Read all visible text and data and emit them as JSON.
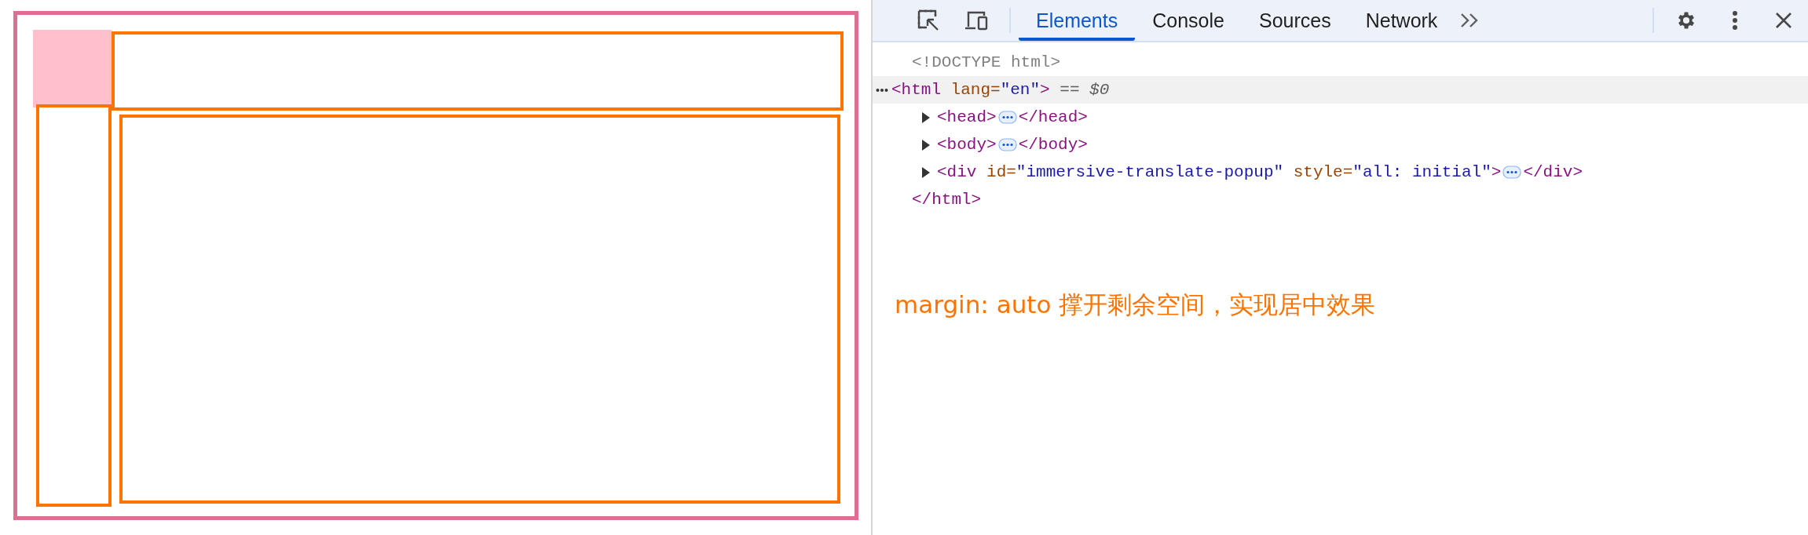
{
  "toolbar": {
    "tabs": [
      {
        "label": "Elements",
        "selected": true
      },
      {
        "label": "Console",
        "selected": false
      },
      {
        "label": "Sources",
        "selected": false
      },
      {
        "label": "Network",
        "selected": false
      }
    ]
  },
  "dom_tree": [
    {
      "indent": false,
      "expandable": false,
      "selected": false,
      "tokens": [
        {
          "kind": "doctype",
          "text": "<!DOCTYPE html>"
        }
      ]
    },
    {
      "indent": false,
      "expandable": false,
      "selected": true,
      "tokens": [
        {
          "kind": "tag",
          "text": "<html"
        },
        {
          "kind": "attr",
          "text": " lang="
        },
        {
          "kind": "value",
          "text": "\"en\""
        },
        {
          "kind": "tag",
          "text": ">"
        },
        {
          "kind": "note",
          "text": " == "
        },
        {
          "kind": "ref",
          "text": "$0"
        }
      ]
    },
    {
      "indent": true,
      "expandable": true,
      "expanded": false,
      "selected": false,
      "tokens": [
        {
          "kind": "tag",
          "text": "<head>"
        },
        {
          "kind": "ellipsis"
        },
        {
          "kind": "tag",
          "text": "</head>"
        }
      ]
    },
    {
      "indent": true,
      "expandable": true,
      "expanded": false,
      "selected": false,
      "tokens": [
        {
          "kind": "tag",
          "text": "<body>"
        },
        {
          "kind": "ellipsis"
        },
        {
          "kind": "tag",
          "text": "</body>"
        }
      ]
    },
    {
      "indent": true,
      "expandable": true,
      "expanded": false,
      "selected": false,
      "tokens": [
        {
          "kind": "tag",
          "text": "<div"
        },
        {
          "kind": "attr",
          "text": " id="
        },
        {
          "kind": "value",
          "text": "\"immersive-translate-popup\""
        },
        {
          "kind": "attr",
          "text": " style="
        },
        {
          "kind": "value",
          "text": "\"all: initial\""
        },
        {
          "kind": "tag",
          "text": ">"
        },
        {
          "kind": "ellipsis"
        },
        {
          "kind": "tag",
          "text": "</div>"
        }
      ]
    },
    {
      "indent": false,
      "expandable": false,
      "selected": false,
      "tokens": [
        {
          "kind": "tag",
          "text": "</html>"
        }
      ]
    }
  ],
  "annotation": "margin: auto 撑开剩余空间，实现居中效果"
}
